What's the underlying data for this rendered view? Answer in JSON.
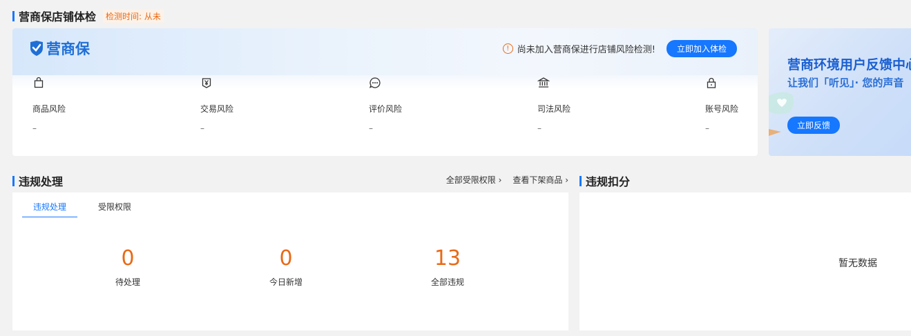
{
  "header": {
    "title": "营商保店铺体检",
    "check_time": "检测时间: 从未"
  },
  "store_card": {
    "logo_text": "营商保",
    "notice": "尚未加入营商保进行店铺风险检测!",
    "join_button": "立即加入体检",
    "risks": [
      {
        "label": "商品风险",
        "value": "–",
        "icon": "shopping-bag-icon"
      },
      {
        "label": "交易风险",
        "value": "–",
        "icon": "yen-receipt-icon"
      },
      {
        "label": "评价风险",
        "value": "–",
        "icon": "chat-bubble-icon"
      },
      {
        "label": "司法风险",
        "value": "–",
        "icon": "courthouse-icon"
      },
      {
        "label": "账号风险",
        "value": "–",
        "icon": "lock-icon"
      }
    ]
  },
  "banner": {
    "title": "营商环境用户反馈中心",
    "subtitle": "让我们「听见」· 您的声音",
    "button": "立即反馈"
  },
  "violations": {
    "title": "违规处理",
    "links": [
      "全部受限权限 ›",
      "查看下架商品 ›"
    ],
    "tabs": [
      "违规处理",
      "受限权限"
    ],
    "stats": [
      {
        "value": "0",
        "label": "待处理"
      },
      {
        "value": "0",
        "label": "今日新增"
      },
      {
        "value": "13",
        "label": "全部违规"
      }
    ]
  },
  "deductions": {
    "title": "违规扣分",
    "empty": "暂无数据"
  },
  "colors": {
    "accent": "#1677ff",
    "warning": "#e86a17"
  }
}
